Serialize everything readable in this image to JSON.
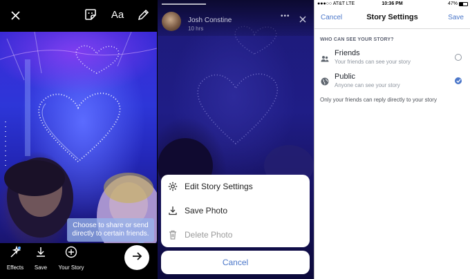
{
  "editor": {
    "tooltip": "Choose to share or send directly to certain friends.",
    "effects_label": "Effects",
    "save_label": "Save",
    "your_story_label": "Your Story",
    "text_tool_label": "Aa"
  },
  "viewer": {
    "user_name": "Josh Constine",
    "time_ago": "10 hrs",
    "more_label": "•••",
    "actions": [
      {
        "icon": "gear-icon",
        "label": "Edit Story Settings"
      },
      {
        "icon": "download-icon",
        "label": "Save Photo"
      },
      {
        "icon": "trash-icon",
        "label": "Delete Photo"
      }
    ],
    "cancel_label": "Cancel"
  },
  "settings": {
    "status": {
      "carrier": "●●●○○ AT&T  LTE",
      "time": "10:36 PM",
      "battery": "47%"
    },
    "nav": {
      "cancel": "Cancel",
      "title": "Story Settings",
      "save": "Save"
    },
    "section_header": "WHO CAN SEE YOUR STORY?",
    "options": [
      {
        "title": "Friends",
        "subtitle": "Your friends can see your story",
        "selected": false
      },
      {
        "title": "Public",
        "subtitle": "Anyone can see your story",
        "selected": true
      }
    ],
    "note": "Only your friends can reply directly to your story"
  },
  "colors": {
    "accent": "#4a76c9",
    "photo_blue": "#2d36d8",
    "sheet_bg": "#ffffff"
  }
}
